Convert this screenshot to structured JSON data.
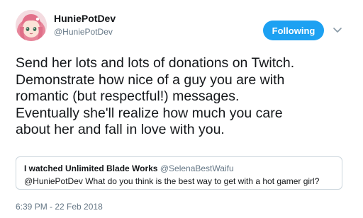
{
  "author": {
    "display_name": "HuniePotDev",
    "handle": "@HuniePotDev",
    "avatar": "anime-character-avatar"
  },
  "follow_button": {
    "label": "Following",
    "color": "#1da1f2"
  },
  "menu_icon": "chevron-down-icon",
  "tweet": {
    "lines": [
      "Send her lots and lots of donations on Twitch.",
      "Demonstrate how nice of a guy you are with",
      "romantic (but respectful!) messages.",
      "Eventually she'll realize how much you care",
      "about her and fall in love with you."
    ]
  },
  "quoted_tweet": {
    "display_name": "I watched Unlimited Blade Works",
    "handle": "@SelenaBestWaifu",
    "text": "@HuniePotDev What do you think is the best way to get with a hot gamer girl?"
  },
  "timestamp": "6:39 PM - 22 Feb 2018"
}
